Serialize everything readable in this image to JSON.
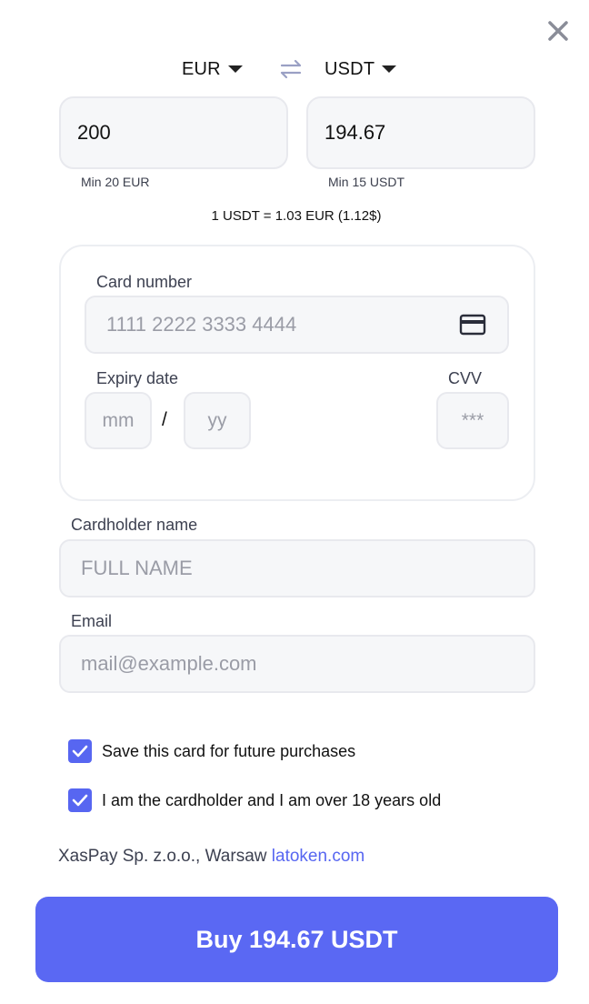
{
  "exchange": {
    "from_currency": "EUR",
    "to_currency": "USDT",
    "from_amount": "200",
    "to_amount": "194.67",
    "from_min": "Min 20 EUR",
    "to_min": "Min 15 USDT",
    "rate": "1 USDT = 1.03 EUR (1.12$)"
  },
  "card": {
    "number_label": "Card number",
    "number_placeholder": "1111 2222 3333 4444",
    "expiry_label": "Expiry date",
    "month_placeholder": "mm",
    "separator": "/",
    "year_placeholder": "yy",
    "cvv_label": "CVV",
    "cvv_placeholder": "***"
  },
  "cardholder": {
    "label": "Cardholder name",
    "placeholder": "FULL NAME"
  },
  "email": {
    "label": "Email",
    "placeholder": "mail@example.com"
  },
  "checkboxes": [
    {
      "label": "Save this card for future purchases",
      "checked": true
    },
    {
      "label": "I am the cardholder and I am over 18 years old",
      "checked": true
    }
  ],
  "footer": {
    "company": "XasPay Sp. z.o.o., Warsaw",
    "link": "latoken.com"
  },
  "buy_button": "Buy 194.67 USDT",
  "colors": {
    "accent": "#5766f1",
    "field_bg": "#f6f7f9",
    "border": "#e8e9ee"
  },
  "icons": [
    "close-icon",
    "swap-icon",
    "caret-down-icon",
    "credit-card-icon",
    "checkmark-icon"
  ]
}
